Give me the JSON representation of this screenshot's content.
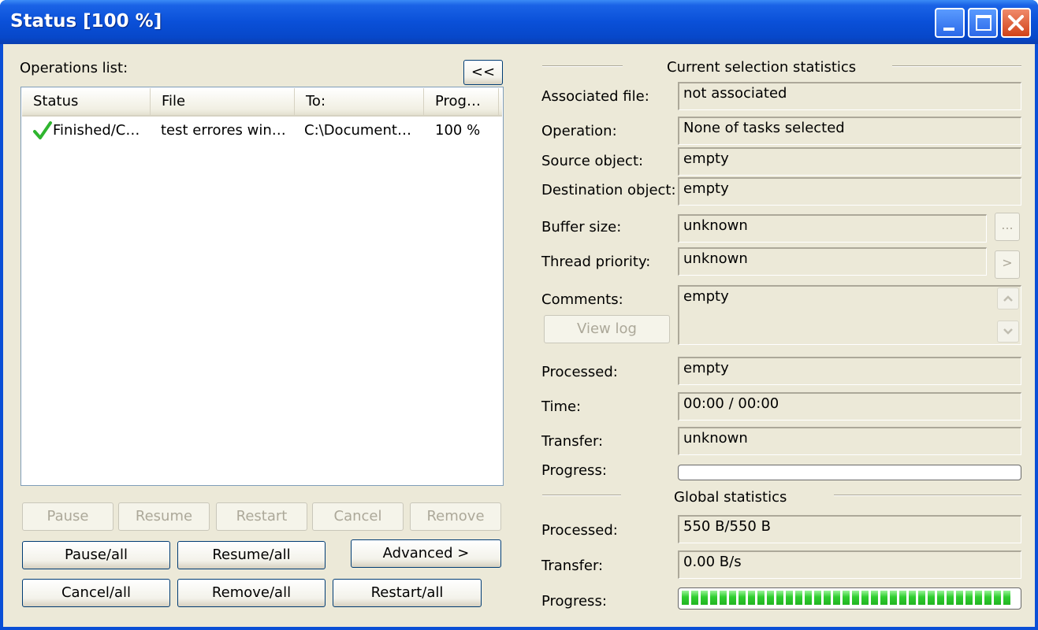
{
  "window": {
    "title": "Status [100 %]"
  },
  "left": {
    "operations_label": "Operations list:",
    "collapse_button": "<<",
    "columns": [
      "Status",
      "File",
      "To:",
      "Prog…"
    ],
    "rows": [
      {
        "status": "Finished/C…",
        "file": "test errores win…",
        "to": "C:\\Document…",
        "progress": "100 %"
      }
    ],
    "task_buttons": {
      "pause": "Pause",
      "resume": "Resume",
      "restart": "Restart",
      "cancel": "Cancel",
      "remove": "Remove"
    },
    "all_buttons": {
      "pause_all": "Pause/all",
      "resume_all": "Resume/all",
      "advanced": "Advanced >",
      "cancel_all": "Cancel/all",
      "remove_all": "Remove/all",
      "restart_all": "Restart/all"
    }
  },
  "current": {
    "heading": "Current selection statistics",
    "associated_file_label": "Associated file:",
    "associated_file": "not associated",
    "operation_label": "Operation:",
    "operation": "None of tasks selected",
    "source_label": "Source object:",
    "source": "empty",
    "destination_label": "Destination object:",
    "destination": "empty",
    "buffer_label": "Buffer size:",
    "buffer": "unknown",
    "buffer_button": "...",
    "priority_label": "Thread priority:",
    "priority": "unknown",
    "priority_button": ">",
    "comments_label": "Comments:",
    "comments": "empty",
    "view_log": "View log",
    "processed_label": "Processed:",
    "processed": "empty",
    "time_label": "Time:",
    "time": "00:00 / 00:00",
    "transfer_label": "Transfer:",
    "transfer": "unknown",
    "progress_label": "Progress:",
    "progress_fraction": 0
  },
  "global": {
    "heading": "Global statistics",
    "processed_label": "Processed:",
    "processed": "550 B/550 B",
    "transfer_label": "Transfer:",
    "transfer": "0.00 B/s",
    "progress_label": "Progress:",
    "progress_fraction": 1.0
  },
  "icons": {
    "status_finished": "check-icon",
    "check_color": "#2fb52f"
  }
}
